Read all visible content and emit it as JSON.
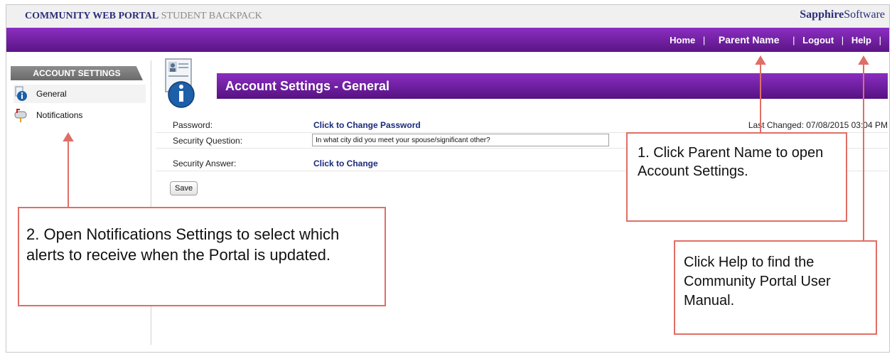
{
  "header": {
    "brand_bold": "COMMUNITY WEB PORTAL",
    "brand_light": "STUDENT BACKPACK",
    "company_bold": "Sapphire",
    "company_light": "Software"
  },
  "nav": {
    "home": "Home",
    "parent_name": "Parent Name",
    "logout": "Logout",
    "help": "Help",
    "sep": "|"
  },
  "sidebar": {
    "header": "ACCOUNT SETTINGS",
    "items": [
      {
        "label": "General",
        "icon": "info-icon"
      },
      {
        "label": "Notifications",
        "icon": "mailbox-icon"
      }
    ]
  },
  "main": {
    "title": "Account Settings - General",
    "password_label": "Password:",
    "password_link": "Click to Change Password",
    "last_changed": "Last Changed: 07/08/2015 03:04 PM",
    "security_question_label": "Security Question:",
    "security_question_value": "In what city did you meet your spouse/significant other?",
    "security_answer_label": "Security Answer:",
    "security_answer_link": "Click to Change",
    "save_label": "Save"
  },
  "callouts": {
    "parent": "1. Click Parent Name to open Account Settings.",
    "notifications": "2. Open Notifications Settings to select which alerts to receive when the Portal is updated.",
    "help": "Click Help to find the Community Portal User Manual."
  },
  "colors": {
    "accent_purple": "#7b24b0",
    "callout_border": "#e06e66",
    "link_blue": "#1a2a7a"
  }
}
